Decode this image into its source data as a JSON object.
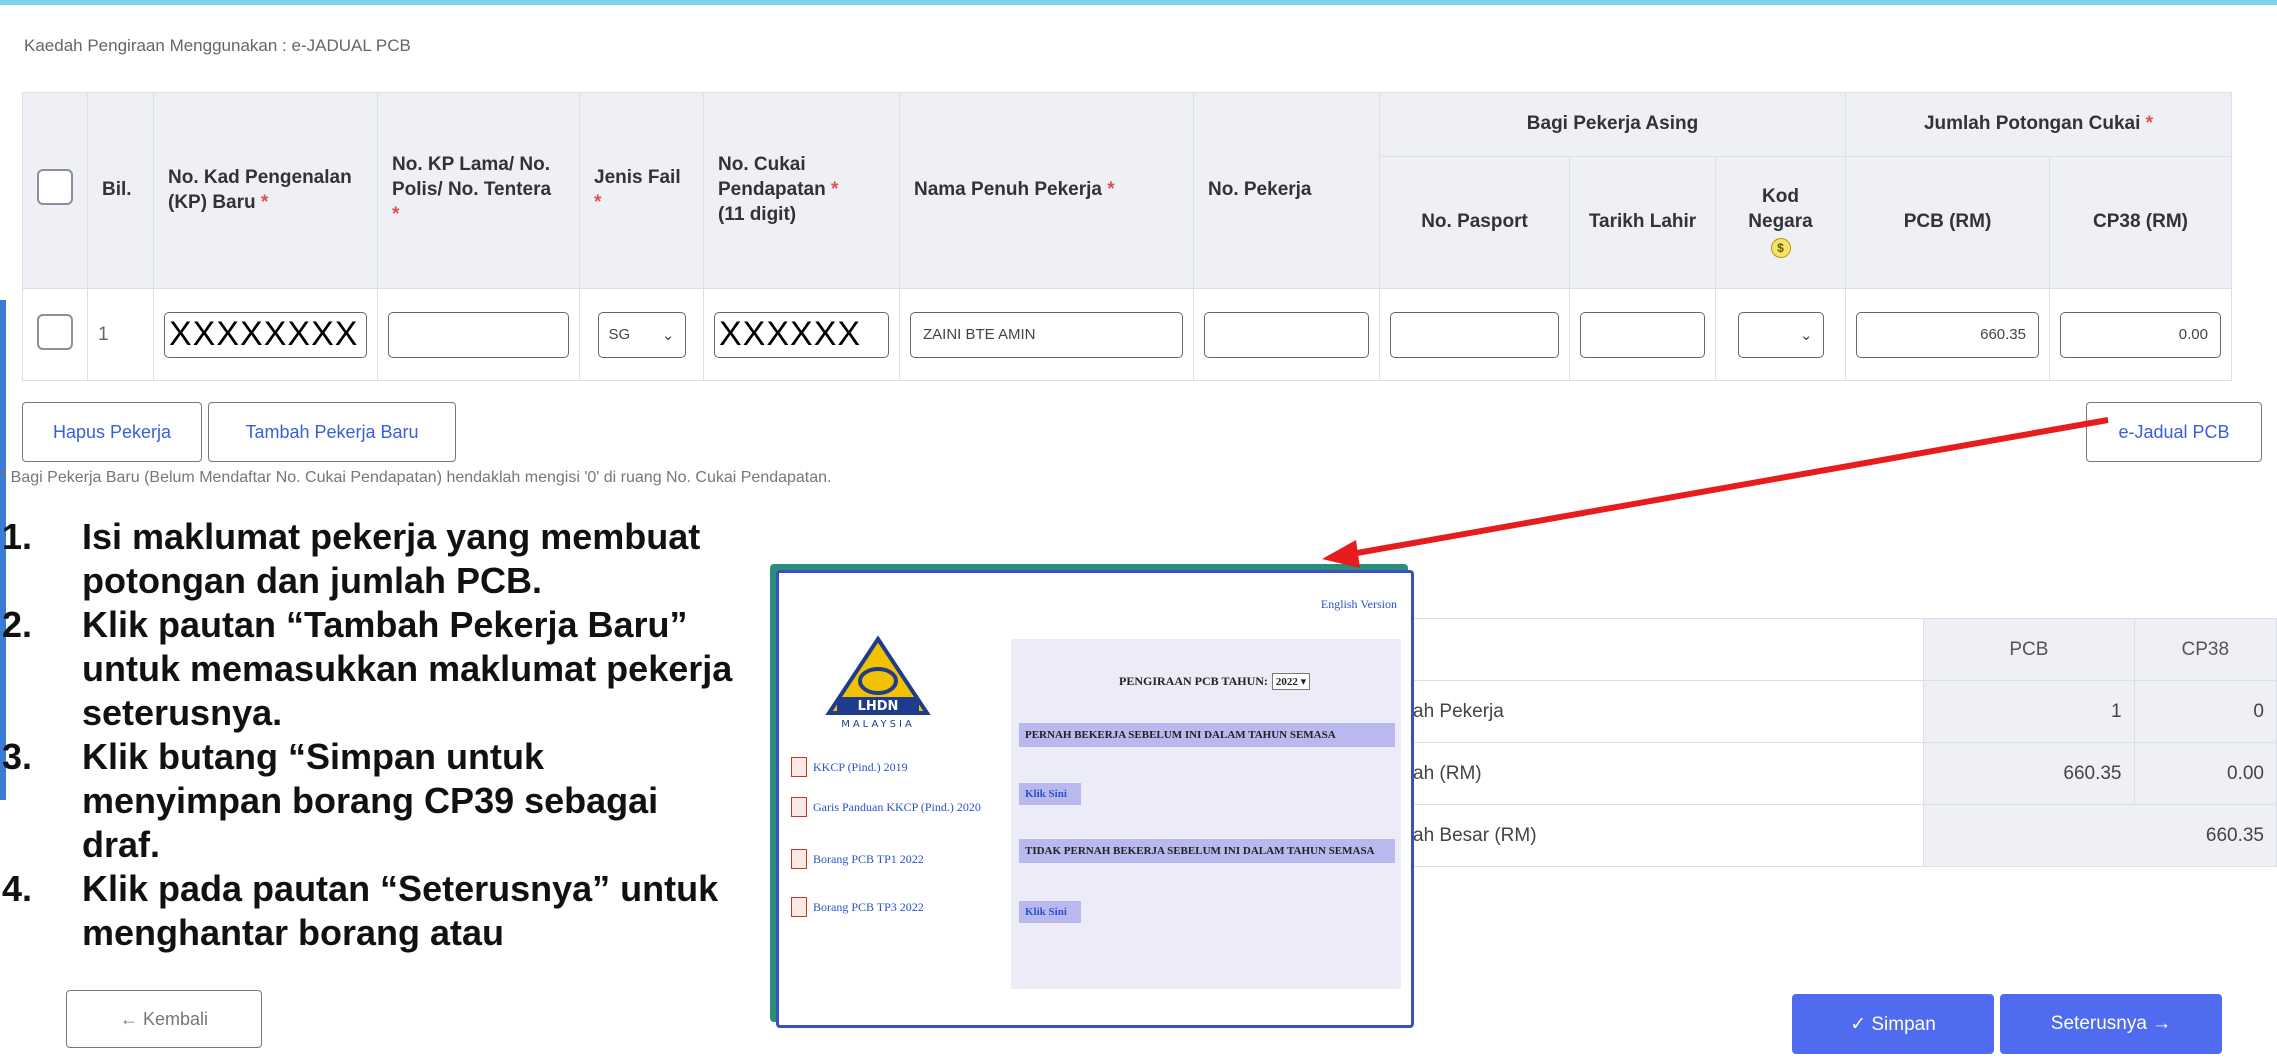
{
  "method_label": "Kaedah Pengiraan Menggunakan : e-JADUAL PCB",
  "table": {
    "headers": {
      "bil": "Bil.",
      "kp_baru": "No. Kad Pengenalan (KP) Baru",
      "kp_lama": "No. KP Lama/ No. Polis/ No. Tentera",
      "jenis_fail": "Jenis Fail",
      "cukai": "No. Cukai Pendapatan",
      "cukai_sub": "(11 digit)",
      "nama": "Nama Penuh Pekerja",
      "no_pekerja": "No. Pekerja",
      "group_asing": "Bagi Pekerja Asing",
      "pasport": "No. Pasport",
      "tarikh": "Tarikh Lahir",
      "kod_negara": "Kod Negara",
      "group_jumlah": "Jumlah Potongan Cukai",
      "pcb": "PCB (RM)",
      "cp38": "CP38 (RM)",
      "required_mark": "*"
    },
    "row": {
      "bil": "1",
      "kp_baru": "XXXXXXXX",
      "kp_lama": "",
      "jenis_fail": "SG",
      "cukai": "XXXXXX",
      "nama": "ZAINI BTE AMIN",
      "no_pekerja": "",
      "pasport": "",
      "tarikh": "",
      "kod_negara": "",
      "pcb": "660.35",
      "cp38": "0.00"
    }
  },
  "buttons": {
    "hapus": "Hapus Pekerja",
    "tambah": "Tambah Pekerja Baru",
    "ejadual": "e-Jadual PCB",
    "kembali": "← Kembali",
    "simpan": "✓  Simpan",
    "seterusnya": "Seterusnya →"
  },
  "note": "* Bagi Pekerja Baru (Belum Mendaftar No. Cukai Pendapatan) hendaklah mengisi '0' di ruang No. Cukai Pendapatan.",
  "instructions": [
    {
      "num": "1.",
      "text": "Isi maklumat pekerja yang membuat  potongan dan jumlah PCB."
    },
    {
      "num": "2.",
      "text": "Klik pautan “Tambah Pekerja Baru”  untuk memasukkan maklumat pekerja  seterusnya."
    },
    {
      "num": "3.",
      "text": "Klik butang “Simpan untuk menyimpan borang CP39 sebagai draf."
    },
    {
      "num": "4.",
      "text": "Klik pada pautan “Seterusnya” untuk  menghantar borang atau"
    }
  ],
  "summary": {
    "col_pcb": "PCB",
    "col_cp38": "CP38",
    "rows": [
      {
        "label": "ah Pekerja",
        "pcb": "1",
        "cp38": "0"
      },
      {
        "label": "ah (RM)",
        "pcb": "660.35",
        "cp38": "0.00"
      }
    ],
    "total_label": "ah Besar (RM)",
    "total_value": "660.35"
  },
  "popup": {
    "english": "English Version",
    "logo_text": "LHDN",
    "logo_sub": "MALAYSIA",
    "title": "PENGIRAAN PCB TAHUN:",
    "year": "2022 ▾",
    "links": [
      "KKCP (Pind.) 2019",
      "Garis Panduan KKCP (Pind.) 2020",
      "Borang PCB TP1 2022",
      "Borang PCB TP3 2022"
    ],
    "option1": "PERNAH BEKERJA SEBELUM INI DALAM TAHUN SEMASA",
    "option2": "TIDAK PERNAH BEKERJA SEBELUM INI DALAM TAHUN SEMASA",
    "klik": "Klik Sini"
  },
  "colors": {
    "accent": "#4f6bf0",
    "arrow": "#e81c1c",
    "header_bg": "#eef0f5"
  }
}
